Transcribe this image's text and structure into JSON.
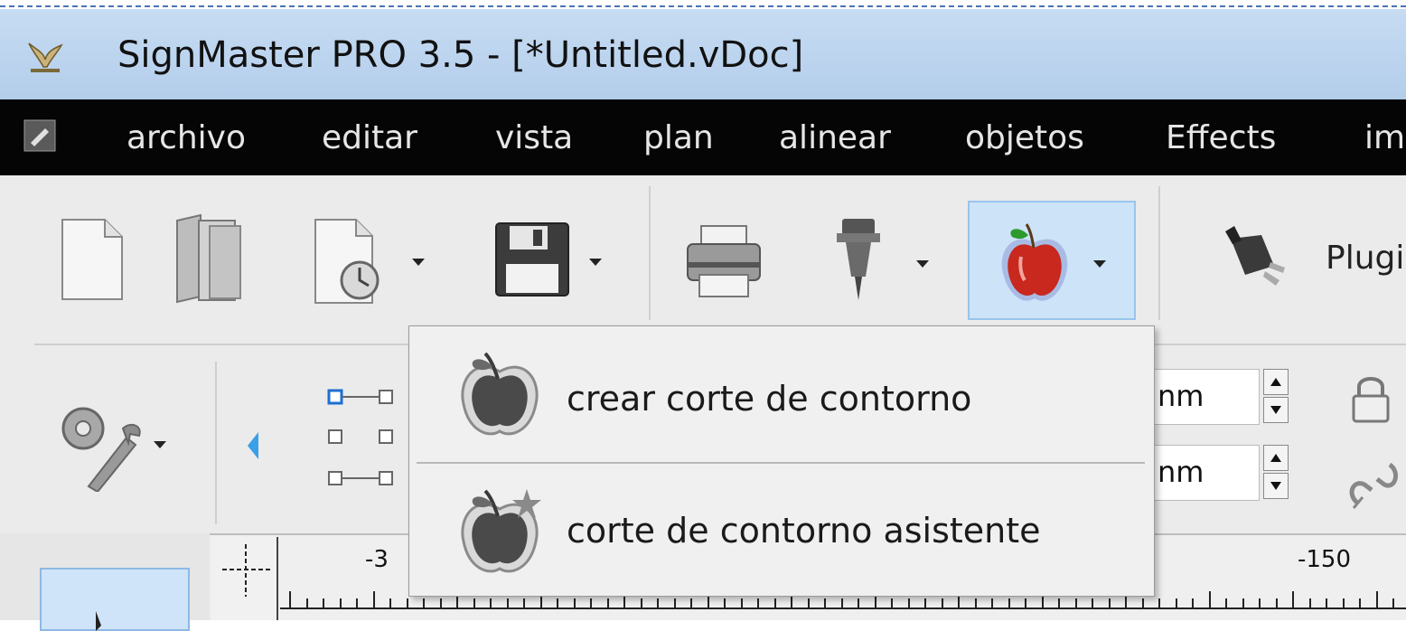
{
  "window": {
    "title": "SignMaster PRO 3.5 - [*Untitled.vDoc]"
  },
  "menu": {
    "items": [
      "archivo",
      "editar",
      "vista",
      "plan",
      "alinear",
      "objetos",
      "Effects",
      "im"
    ]
  },
  "toolbar": {
    "plugin_label": "Plugi"
  },
  "size_fields": {
    "width_value": "nm",
    "height_value": "nm"
  },
  "ruler": {
    "labels": [
      "-3",
      "-150"
    ]
  },
  "dropdown": {
    "items": [
      {
        "label": "crear corte de contorno"
      },
      {
        "label": "corte de contorno asistente"
      }
    ]
  },
  "colors": {
    "title_bar": "#bcd3ee",
    "menu_bar": "#050505",
    "active_button": "#cde3f7",
    "apple_red": "#c8281e"
  },
  "icons": [
    "app-logo-icon",
    "menu-app-icon",
    "new-document-icon",
    "open-folder-icon",
    "recent-document-icon",
    "save-icon",
    "print-icon",
    "cutter-tool-icon",
    "contour-cut-apple-icon",
    "plugin-icon",
    "settings-tools-icon",
    "lock-icon",
    "link-icon",
    "apple-contour-icon",
    "apple-wizard-icon"
  ]
}
